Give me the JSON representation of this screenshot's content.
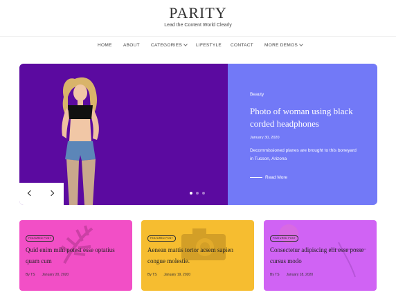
{
  "header": {
    "logo": "PARITY",
    "tagline": "Lead the Content World Clearly"
  },
  "nav": {
    "items": [
      {
        "label": "HOME"
      },
      {
        "label": "ABOUT"
      },
      {
        "label": "CATEGORIES"
      },
      {
        "label": "LIFESTYLE"
      },
      {
        "label": "CONTACT"
      },
      {
        "label": "MORE DEMOS"
      }
    ]
  },
  "hero": {
    "category": "Beauty",
    "title": "Photo of woman using black corded headphones",
    "date": "January 30, 2020",
    "excerpt": "Decommissioned planes are brought to this boneyard in Tucson, Arizona",
    "read_more": "Read More",
    "colors": {
      "left": "#5b0aa0",
      "right": "#7279f7"
    }
  },
  "cards": [
    {
      "badge": "FEATURED POST",
      "title": "Quid enim mihi potest esse optatius quam cum",
      "author": "By TS",
      "date": "January 20, 2020",
      "color": "#f24fc6"
    },
    {
      "badge": "FEATURED POST",
      "title": "Aenean mattis tortor acsem sapien congue molestie.",
      "author": "By TS",
      "date": "January 19, 2020",
      "color": "#f6bd30"
    },
    {
      "badge": "FEATURED POST",
      "title": "Consectetur adipiscing elit esse posse cursus modo",
      "author": "By TS",
      "date": "January 18, 2020",
      "color": "#d063f4"
    }
  ]
}
